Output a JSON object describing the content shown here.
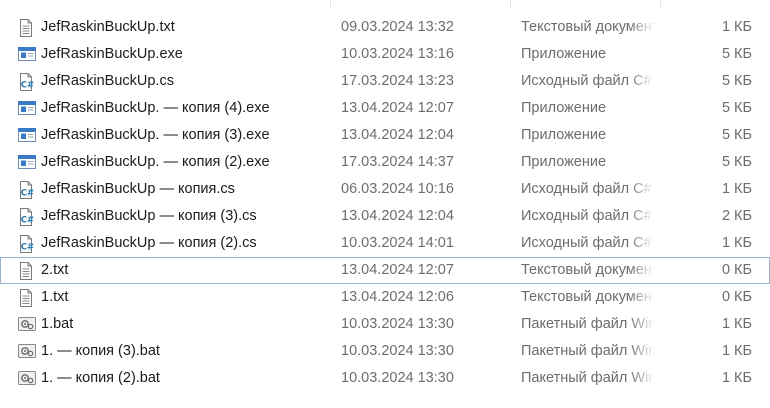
{
  "files": [
    {
      "name": "JefRaskinBuckUp.txt",
      "date": "09.03.2024 13:32",
      "type": "Текстовый документ",
      "size": "1 КБ",
      "icon": "text-file-icon"
    },
    {
      "name": "JefRaskinBuckUp.exe",
      "date": "10.03.2024 13:16",
      "type": "Приложение",
      "size": "5 КБ",
      "icon": "application-icon"
    },
    {
      "name": "JefRaskinBuckUp.cs",
      "date": "17.03.2024 13:23",
      "type": "Исходный файл C#",
      "size": "5 КБ",
      "icon": "csharp-file-icon"
    },
    {
      "name": "JefRaskinBuckUp. — копия (4).exe",
      "date": "13.04.2024 12:07",
      "type": "Приложение",
      "size": "5 КБ",
      "icon": "application-icon"
    },
    {
      "name": "JefRaskinBuckUp. — копия (3).exe",
      "date": "13.04.2024 12:04",
      "type": "Приложение",
      "size": "5 КБ",
      "icon": "application-icon"
    },
    {
      "name": "JefRaskinBuckUp. — копия (2).exe",
      "date": "17.03.2024 14:37",
      "type": "Приложение",
      "size": "5 КБ",
      "icon": "application-icon"
    },
    {
      "name": "JefRaskinBuckUp — копия.cs",
      "date": "06.03.2024 10:16",
      "type": "Исходный файл C#",
      "size": "1 КБ",
      "icon": "csharp-file-icon"
    },
    {
      "name": "JefRaskinBuckUp — копия (3).cs",
      "date": "13.04.2024 12:04",
      "type": "Исходный файл C#",
      "size": "2 КБ",
      "icon": "csharp-file-icon"
    },
    {
      "name": "JefRaskinBuckUp — копия (2).cs",
      "date": "10.03.2024 14:01",
      "type": "Исходный файл C#",
      "size": "1 КБ",
      "icon": "csharp-file-icon"
    },
    {
      "name": "2.txt",
      "date": "13.04.2024 12:07",
      "type": "Текстовый документ",
      "size": "0 КБ",
      "icon": "text-file-icon",
      "focused": true
    },
    {
      "name": "1.txt",
      "date": "13.04.2024 12:06",
      "type": "Текстовый документ",
      "size": "0 КБ",
      "icon": "text-file-icon"
    },
    {
      "name": "1.bat",
      "date": "10.03.2024 13:30",
      "type": "Пакетный файл Windows",
      "size": "1 КБ",
      "icon": "batch-file-icon"
    },
    {
      "name": "1. — копия (3).bat",
      "date": "10.03.2024 13:30",
      "type": "Пакетный файл Windows",
      "size": "1 КБ",
      "icon": "batch-file-icon"
    },
    {
      "name": "1. — копия (2).bat",
      "date": "10.03.2024 13:30",
      "type": "Пакетный файл Windows",
      "size": "1 КБ",
      "icon": "batch-file-icon"
    }
  ]
}
